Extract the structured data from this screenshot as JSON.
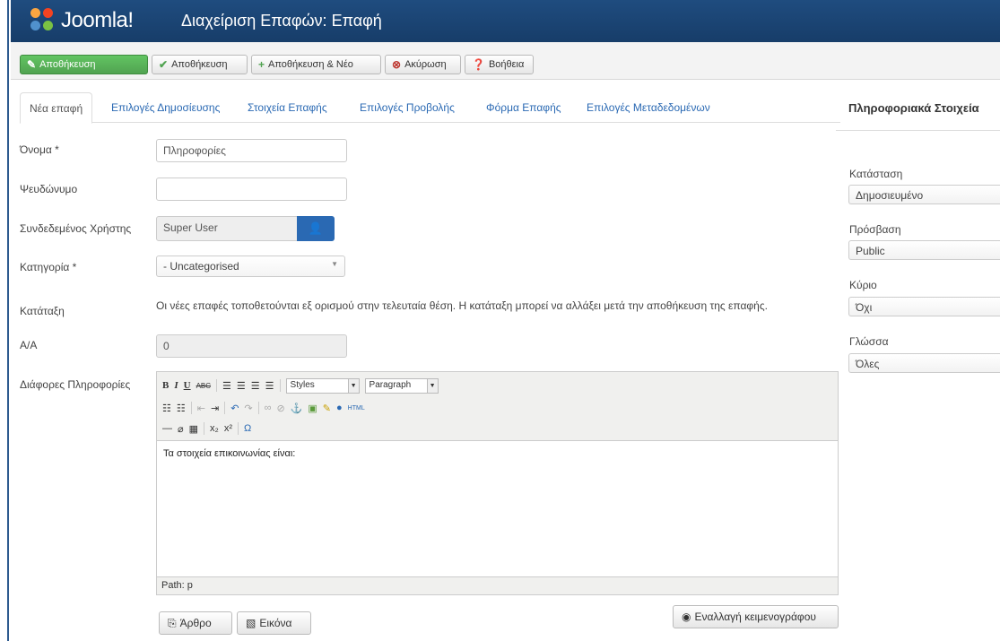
{
  "header": {
    "logo_text": "Joomla!",
    "title": "Διαχείριση Επαφών: Επαφή"
  },
  "toolbar": {
    "save_close": "Αποθήκευση",
    "save": "Αποθήκευση",
    "save_new": "Αποθήκευση & Νέο",
    "cancel": "Ακύρωση",
    "help": "Βοήθεια"
  },
  "tabs": [
    {
      "label": "Νέα επαφή"
    },
    {
      "label": "Επιλογές Δημοσίευσης"
    },
    {
      "label": "Στοιχεία Επαφής"
    },
    {
      "label": "Επιλογές Προβολής"
    },
    {
      "label": "Φόρμα Επαφής"
    },
    {
      "label": "Επιλογές Μεταδεδομένων"
    }
  ],
  "form": {
    "name_label": "Όνομα *",
    "name_value": "Πληροφορίες",
    "alias_label": "Ψευδώνυμο",
    "alias_value": "",
    "user_label": "Συνδεδεμένος Χρήστης",
    "user_value": "Super User",
    "category_label": "Κατηγορία *",
    "category_value": "- Uncategorised",
    "ordering_label": "Κατάταξη",
    "ordering_text": "Οι νέες επαφές τοποθετούνται εξ ορισμού στην τελευταία θέση. Η κατάταξη μπορεί να αλλάξει μετά την αποθήκευση της επαφής.",
    "id_label": "Α/Α",
    "id_value": "0",
    "misc_label": "Διάφορες Πληροφορίες"
  },
  "editor": {
    "styles": "Styles",
    "paragraph": "Paragraph",
    "content": "Τα στοιχεία επικοινωνίας είναι:",
    "path": "Path: p"
  },
  "editor_buttons": {
    "article": "Άρθρο",
    "image": "Εικόνα",
    "toggle": "Εναλλαγή κειμενογράφου"
  },
  "sidebar": {
    "title": "Πληροφοριακά Στοιχεία",
    "status_label": "Κατάσταση",
    "status_value": "Δημοσιευμένο",
    "access_label": "Πρόσβαση",
    "access_value": "Public",
    "featured_label": "Κύριο",
    "featured_value": "Όχι",
    "language_label": "Γλώσσα",
    "language_value": "Όλες"
  }
}
